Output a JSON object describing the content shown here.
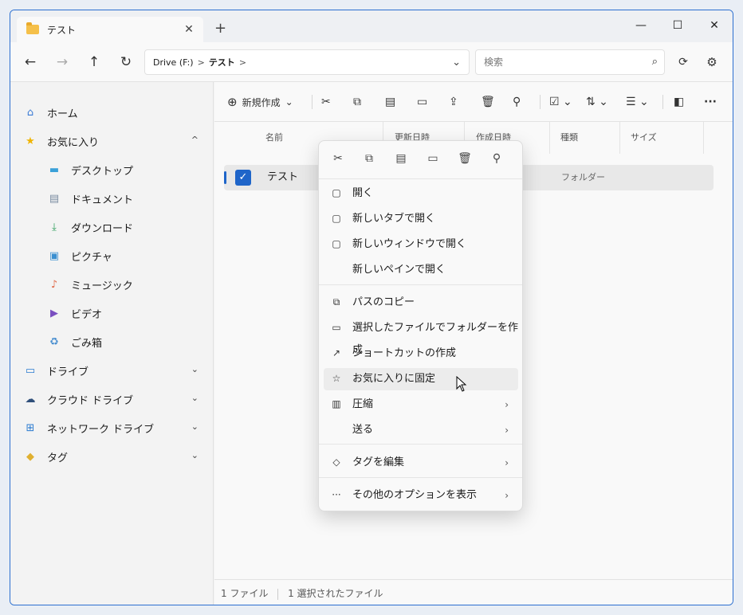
{
  "tab": {
    "title": "テスト",
    "close": "✕",
    "new": "+"
  },
  "window": {
    "minimize": "—",
    "maximize": "☐",
    "close": "✕"
  },
  "nav": {
    "back": "←",
    "forward": "→",
    "up": "↑",
    "refresh": "↻",
    "address": {
      "drive": "Drive (F:)",
      "sep1": ">",
      "current": "テスト",
      "sep2": ">",
      "dropdown": "⌄"
    },
    "search_placeholder": "検索",
    "search_icon": "⌕",
    "extra1": "⟳",
    "settings": "⚙"
  },
  "sidebar": {
    "items": [
      {
        "label": "ホーム",
        "icon": "home-icon",
        "glyph": "⌂",
        "color": "#3a7bd5"
      },
      {
        "label": "お気に入り",
        "icon": "star-icon",
        "glyph": "★",
        "color": "#f0b400",
        "chev": "^"
      },
      {
        "label": "デスクトップ",
        "icon": "desktop-icon",
        "glyph": "▬",
        "color": "#3aa0d8"
      },
      {
        "label": "ドキュメント",
        "icon": "document-icon",
        "glyph": "▤",
        "color": "#7a8ba0"
      },
      {
        "label": "ダウンロード",
        "icon": "download-icon",
        "glyph": "⤓",
        "color": "#2e9e5b"
      },
      {
        "label": "ピクチャ",
        "icon": "picture-icon",
        "glyph": "▣",
        "color": "#3a8fd0"
      },
      {
        "label": "ミュージック",
        "icon": "music-icon",
        "glyph": "♪",
        "color": "#e06c4c"
      },
      {
        "label": "ビデオ",
        "icon": "video-icon",
        "glyph": "▶",
        "color": "#7a4fc0"
      },
      {
        "label": "ごみ箱",
        "icon": "recycle-icon",
        "glyph": "♻",
        "color": "#4a8fd0"
      },
      {
        "label": "ドライブ",
        "icon": "drive-icon",
        "glyph": "▭",
        "color": "#2a7bd0",
        "chev": "⌄"
      },
      {
        "label": "クラウド ドライブ",
        "icon": "cloud-drive-icon",
        "glyph": "☁",
        "color": "#2f4f7a",
        "chev": "⌄"
      },
      {
        "label": "ネットワーク ドライブ",
        "icon": "network-drive-icon",
        "glyph": "⊞",
        "color": "#2a7bd0",
        "chev": "⌄"
      },
      {
        "label": "タグ",
        "icon": "tag-icon",
        "glyph": "◆",
        "color": "#e0b030",
        "chev": "⌄"
      }
    ]
  },
  "cmdbar": {
    "new_label": "新規作成",
    "new_icon": "⊕",
    "chevron": "⌄"
  },
  "columns": {
    "name": "名前",
    "col2": "更新日時",
    "col3": "作成日時",
    "type": "種類",
    "size": "サイズ"
  },
  "file": {
    "name": "テスト",
    "kind": "フォルダー",
    "check": "✓"
  },
  "status": {
    "count": "1 ファイル",
    "selected": "1 選択されたファイル"
  },
  "menu": {
    "items": [
      {
        "label": "開く",
        "icon": "open-icon",
        "glyph": "▢",
        "arrow": ""
      },
      {
        "label": "新しいタブで開く",
        "icon": "open-new-tab-icon",
        "glyph": "▢",
        "arrow": ""
      },
      {
        "label": "新しいウィンドウで開く",
        "icon": "open-new-window-icon",
        "glyph": "▢",
        "arrow": ""
      },
      {
        "label": "新しいペインで開く",
        "icon": "",
        "glyph": "",
        "arrow": ""
      },
      {
        "label": "パスのコピー",
        "icon": "copy-path-icon",
        "glyph": "⧉",
        "arrow": ""
      },
      {
        "label": "選択したファイルでフォルダーを作成",
        "icon": "create-folder-icon",
        "glyph": "▭",
        "arrow": ""
      },
      {
        "label": "ショートカットの作成",
        "icon": "shortcut-icon",
        "glyph": "↗",
        "arrow": ""
      },
      {
        "label": "お気に入りに固定",
        "icon": "pin-favorite-icon",
        "glyph": "☆",
        "arrow": ""
      },
      {
        "label": "圧縮",
        "icon": "compress-icon",
        "glyph": "▥",
        "arrow": "›"
      },
      {
        "label": "送る",
        "icon": "",
        "glyph": "",
        "arrow": "›"
      },
      {
        "label": "タグを編集",
        "icon": "tag-edit-icon",
        "glyph": "◇",
        "arrow": "›"
      },
      {
        "label": "その他のオプションを表示",
        "icon": "more-options-icon",
        "glyph": "···",
        "arrow": "›"
      }
    ]
  }
}
